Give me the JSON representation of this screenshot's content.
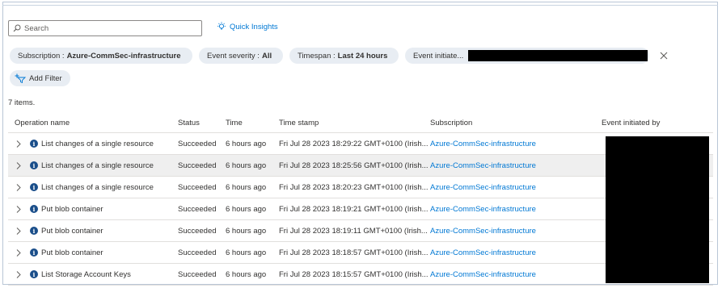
{
  "search": {
    "placeholder": "Search"
  },
  "quick_insights": {
    "label": "Quick Insights"
  },
  "filters": [
    {
      "label": "Subscription :",
      "value": "Azure-CommSec-infrastructure"
    },
    {
      "label": "Event severity :",
      "value": "All"
    },
    {
      "label": "Timespan :",
      "value": "Last 24 hours"
    },
    {
      "label": "Event initiate...",
      "value": ""
    }
  ],
  "add_filter": {
    "label": "Add Filter"
  },
  "items_count": "7 items.",
  "table": {
    "headers": [
      "Operation name",
      "Status",
      "Time",
      "Time stamp",
      "Subscription",
      "Event initiated by"
    ],
    "rows": [
      {
        "operation": "List changes of a single resource",
        "status": "Succeeded",
        "time": "6 hours ago",
        "timestamp": "Fri Jul 28 2023 18:29:22 GMT+0100 (Irish...",
        "subscription": "Azure-CommSec-infrastructure"
      },
      {
        "operation": "List changes of a single resource",
        "status": "Succeeded",
        "time": "6 hours ago",
        "timestamp": "Fri Jul 28 2023 18:25:56 GMT+0100 (Irish...",
        "subscription": "Azure-CommSec-infrastructure"
      },
      {
        "operation": "List changes of a single resource",
        "status": "Succeeded",
        "time": "6 hours ago",
        "timestamp": "Fri Jul 28 2023 18:20:23 GMT+0100 (Irish...",
        "subscription": "Azure-CommSec-infrastructure"
      },
      {
        "operation": "Put blob container",
        "status": "Succeeded",
        "time": "6 hours ago",
        "timestamp": "Fri Jul 28 2023 18:19:21 GMT+0100 (Irish...",
        "subscription": "Azure-CommSec-infrastructure"
      },
      {
        "operation": "Put blob container",
        "status": "Succeeded",
        "time": "6 hours ago",
        "timestamp": "Fri Jul 28 2023 18:19:11 GMT+0100 (Irish...",
        "subscription": "Azure-CommSec-infrastructure"
      },
      {
        "operation": "Put blob container",
        "status": "Succeeded",
        "time": "6 hours ago",
        "timestamp": "Fri Jul 28 2023 18:18:57 GMT+0100 (Irish...",
        "subscription": "Azure-CommSec-infrastructure"
      },
      {
        "operation": "List Storage Account Keys",
        "status": "Succeeded",
        "time": "6 hours ago",
        "timestamp": "Fri Jul 28 2023 18:15:57 GMT+0100 (Irish...",
        "subscription": "Azure-CommSec-infrastructure"
      }
    ]
  },
  "colors": {
    "link": "#0078d4",
    "info_icon": "#1a4e8a",
    "pill_bg": "#e8edf3",
    "selected_row": "#efefef",
    "redaction": "#000000"
  },
  "icons": {
    "search": "search-icon",
    "insights": "lightbulb-icon",
    "add_filter": "add-filter-icon",
    "close": "close-icon",
    "expand": "chevron-right-icon",
    "info": "info-icon"
  }
}
